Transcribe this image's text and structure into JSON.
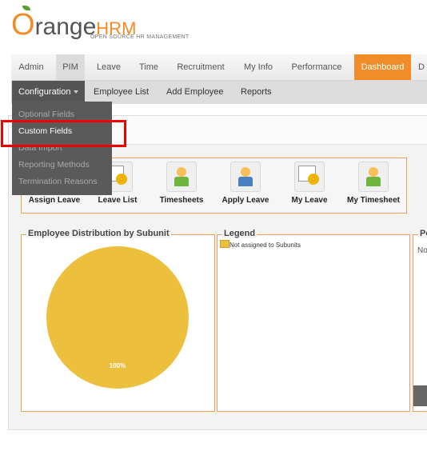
{
  "logo": {
    "brand_o": "O",
    "brand_rest": "range",
    "brand_hrm": "HRM",
    "tagline": "OPEN SOURCE HR MANAGEMENT"
  },
  "topmenu": [
    "Admin",
    "PIM",
    "Leave",
    "Time",
    "Recruitment",
    "My Info",
    "Performance",
    "Dashboard",
    "D"
  ],
  "submenu": {
    "configuration": "Configuration",
    "employee_list": "Employee List",
    "add_employee": "Add Employee",
    "reports": "Reports"
  },
  "dropdown": [
    "Optional Fields",
    "Custom Fields",
    "Data Import",
    "Reporting Methods",
    "Termination Reasons"
  ],
  "quick_launch": [
    "Assign Leave",
    "Leave List",
    "Timesheets",
    "Apply Leave",
    "My Leave",
    "My Timesheet"
  ],
  "panels": {
    "distribution": {
      "title": "Employee Distribution by Subunit",
      "pie_label": "100%"
    },
    "legend": {
      "title": "Legend",
      "item": "Not assigned to Subunits"
    },
    "third": {
      "title": "Po",
      "text": "No"
    }
  },
  "colors": {
    "accent": "#f28c28",
    "pie": "#ecbf3d",
    "highlight": "#ee0000"
  }
}
